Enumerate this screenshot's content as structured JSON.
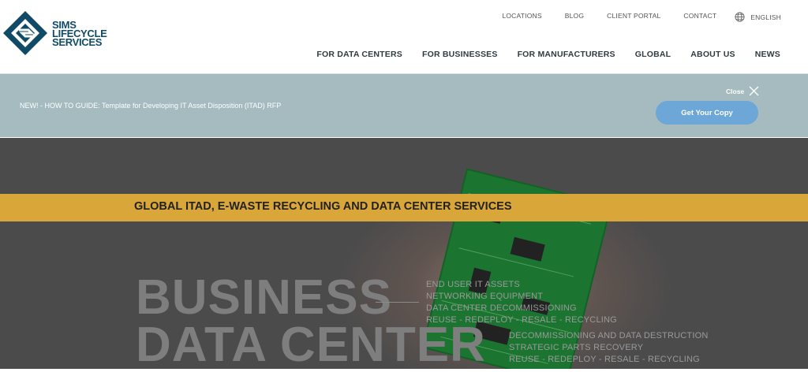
{
  "header": {
    "logo": {
      "line1": "SIMS",
      "line2": "LIFECYCLE",
      "line3": "SERVICES"
    },
    "utility_nav": [
      "LOCATIONS",
      "BLOG",
      "CLIENT PORTAL",
      "CONTACT"
    ],
    "language": "ENGLISH",
    "main_nav": [
      "FOR DATA CENTERS",
      "FOR BUSINESSES",
      "FOR MANUFACTURERS",
      "GLOBAL",
      "ABOUT US",
      "NEWS"
    ]
  },
  "banner": {
    "text": "NEW! - HOW TO GUIDE: Template for Developing IT Asset Disposition (ITAD) RFP",
    "close_label": "Close",
    "cta_label": "Get Your Copy"
  },
  "hero": {
    "stripe_text": "GLOBAL ITAD, E-WASTE RECYCLING AND DATA CENTER SERVICES",
    "heading_line1": "BUSINESS",
    "heading_line2": "DATA CENTER",
    "business_services": [
      "END USER IT ASSETS",
      "NETWORKING EQUIPMENT",
      "DATA CENTER DECOMMISSIONING",
      "REUSE - REDEPLOY - RESALE - RECYCLING"
    ],
    "datacenter_services": [
      "DECOMMISSIONING AND DATA DESTRUCTION",
      "STRATEGIC PARTS RECOVERY",
      "REUSE - REDEPLOY - RESALE - RECYCLING"
    ]
  },
  "colors": {
    "brand": "#0f4a67",
    "banner": "#a5bbc0",
    "cta": "#6ca7d8",
    "stripe": "#d9a63a",
    "hero_bg": "#4b4b4b"
  },
  "icons": [
    "sims-logo-icon",
    "globe-icon",
    "close-icon"
  ]
}
